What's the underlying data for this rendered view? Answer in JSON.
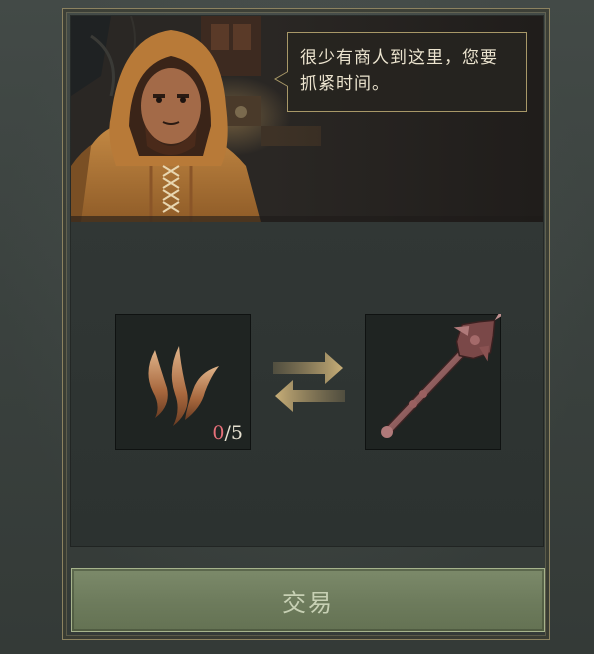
{
  "dialog": {
    "text_line1": "很少有商人到这里，您要",
    "text_line2": "抓紧时间。"
  },
  "trade": {
    "give_item": {
      "icon": "claw-fang-icon",
      "have": "0",
      "separator": "/",
      "need": "5",
      "have_color": "#e8707a"
    },
    "exchange_icon": "exchange-arrows-icon",
    "get_item": {
      "icon": "mace-icon"
    }
  },
  "button": {
    "label": "交易"
  },
  "colors": {
    "accent_gold": "#a89868",
    "button_green": "#6d7b5c"
  }
}
